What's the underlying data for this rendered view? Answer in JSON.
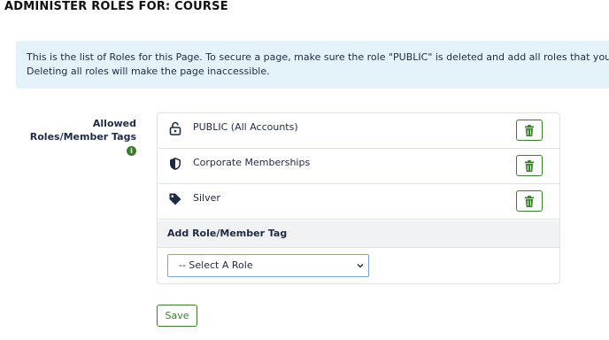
{
  "page": {
    "title": "ADMINISTER ROLES FOR: COURSE"
  },
  "info": {
    "line1": "This is the list of Roles for this Page. To secure a page, make sure the role \"PUBLIC\" is deleted and add all roles that you wish t",
    "line2": "Deleting all roles will make the page inaccessible."
  },
  "roles_label": "Allowed Roles/Member Tags",
  "roles": [
    {
      "name": "PUBLIC (All Accounts)",
      "icon": "unlock-icon"
    },
    {
      "name": "Corporate Memberships",
      "icon": "shield-icon"
    },
    {
      "name": "Silver",
      "icon": "tag-icon"
    }
  ],
  "add_role": {
    "header": "Add Role/Member Tag",
    "select_value": "-- Select A Role"
  },
  "save_label": "Save",
  "colors": {
    "accent": "#3a7d2c",
    "info_bg": "#e3f3f9",
    "text": "#1f2a44"
  }
}
